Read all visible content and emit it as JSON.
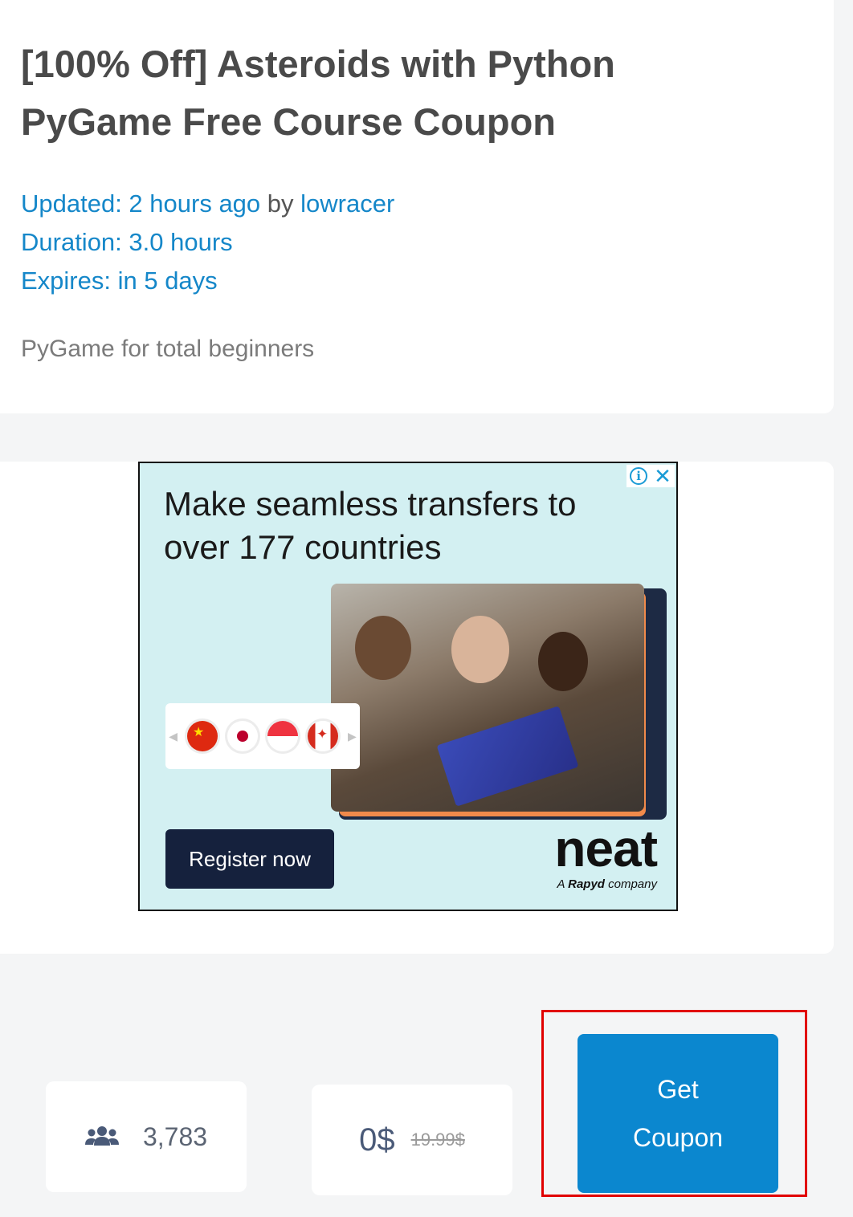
{
  "post": {
    "title": "[100% Off] Asteroids with Python PyGame Free Course Coupon",
    "updated_label": "Updated: 2 hours ago",
    "by_label": "by",
    "author": "lowracer",
    "duration": "Duration: 3.0 hours",
    "expires": "Expires: in 5 days",
    "description": "PyGame for total beginners"
  },
  "ad": {
    "headline": "Make seamless transfers to over 177 countries",
    "cta_label": "Register now",
    "brand": "neat",
    "brand_tagline_prefix": "A",
    "brand_tagline_company": "Rapyd",
    "brand_tagline_suffix": "company",
    "info_icon": "i",
    "close_icon": "✕",
    "flags": [
      "china-flag-icon",
      "japan-flag-icon",
      "singapore-flag-icon",
      "canada-flag-icon"
    ]
  },
  "stats": {
    "students_icon": "users-icon",
    "students_count": "3,783",
    "price_now": "0$",
    "price_old": "19.99$"
  },
  "coupon": {
    "label_line1": "Get",
    "label_line2": "Coupon"
  },
  "colors": {
    "accent": "#0b87cf",
    "link": "#1587c9",
    "highlight": "#e10000",
    "ad_bg": "#d3f0f2"
  }
}
